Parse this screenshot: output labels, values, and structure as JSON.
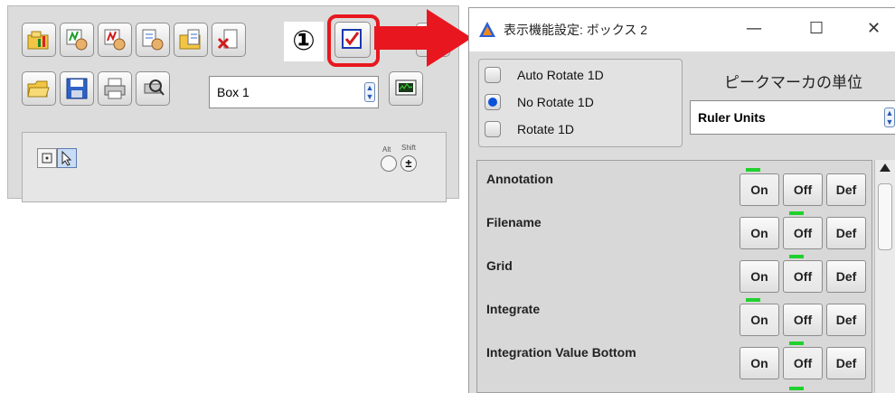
{
  "toolbar": {
    "box_select_value": "Box 1",
    "annotation_number": "①",
    "alt_label": "Alt",
    "shift_label": "Shift",
    "plusminus_label": "±"
  },
  "colors": {
    "highlight": "#e8171f",
    "radio_selected": "#0a53d8",
    "led_on": "#1fd12d"
  },
  "dialog": {
    "title": "表示機能設定: ボックス 2",
    "min_glyph": "—",
    "max_glyph": "☐",
    "close_glyph": "✕",
    "rotate_options": [
      {
        "label": "Auto Rotate 1D",
        "selected": false
      },
      {
        "label": "No Rotate 1D",
        "selected": true
      },
      {
        "label": "Rotate 1D",
        "selected": false
      }
    ],
    "peak_marker_label": "ピークマーカの単位",
    "peak_marker_value": "Ruler Units",
    "items": [
      {
        "label": "Annotation",
        "state": "On"
      },
      {
        "label": "Filename",
        "state": "Off"
      },
      {
        "label": "Grid",
        "state": "Off"
      },
      {
        "label": "Integrate",
        "state": "On"
      },
      {
        "label": "Integration Value Bottom",
        "state": "Off"
      }
    ],
    "btn_on": "On",
    "btn_off": "Off",
    "btn_def": "Def"
  }
}
